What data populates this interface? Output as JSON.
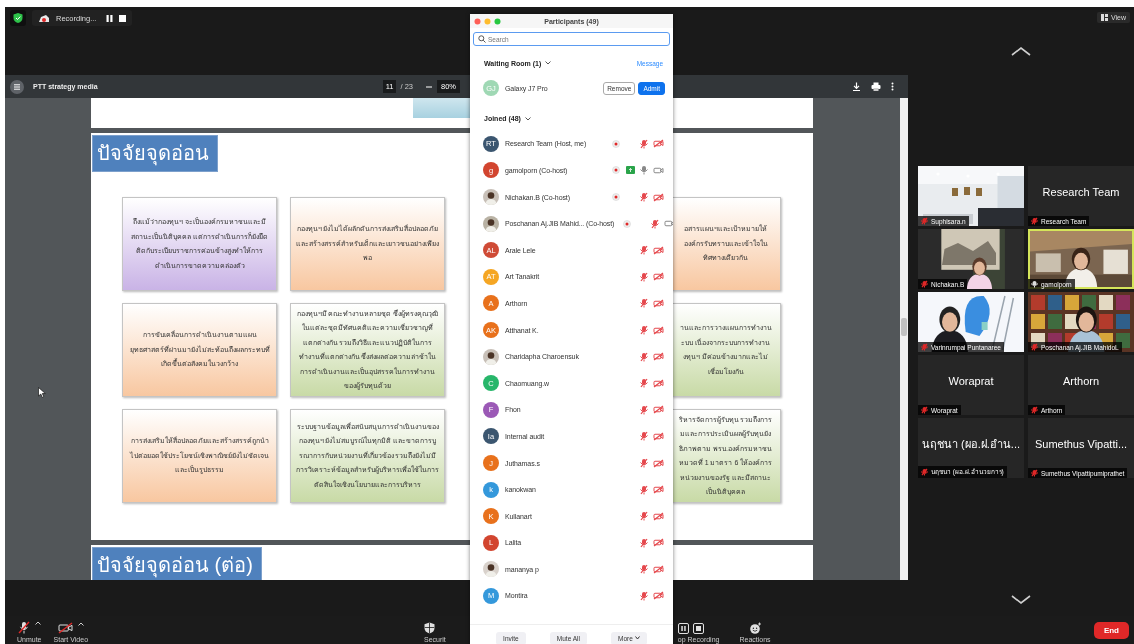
{
  "top_bar": {
    "recording_label": "Recording..."
  },
  "viewer": {
    "title": "PTT strategy media",
    "page": "11",
    "page_total": "/ 23",
    "zoom": "80%"
  },
  "slides": [
    {
      "title": "ปัจจัยจุดอ่อน",
      "boxes": [
        {
          "color": "#c9b3e6",
          "text": "ถึงแม้ว่ากองทุนฯ จะเป็นองค์กรมหาชนและมีสถานะเป็นนิติบุคคล แต่การดำเนินการก็ยังยึดติดกับระเบียบราชการค่อนข้างสูงทำให้การดำเนินการขาดความคล่องตัว"
        },
        {
          "color": "#f8c7a0",
          "text": "กองทุนฯ ยังไม่ได้ผลักดันการส่งเสริมสื่อปลอดภัยและสร้างสรรค์สำหรับเด็กและเยาวชนอย่างเพียงพอ"
        },
        {
          "color": "#f8c7a0",
          "text": "อสารแผนฯและเป้าหมายให้\nองค์กรรับทราบและเข้าใจใน\nทิศทางเดียวกัน"
        },
        {
          "color": "#f8c7a0",
          "text": "การขับเคลื่อนการดำเนินงานตามแผนยุทธศาสตร์ที่ผ่านมายังไม่สะท้อนถึงผลกระทบที่เกิดขึ้นต่อสังคมในวงกว้าง"
        },
        {
          "color": "#c8daa6",
          "text": "กองทุนฯมี คณะทำงานหลายชุด ซึ่งผู้ทรงคุณวุฒิในแต่ละชุดมีทัศนคติและความเชี่ยวชาญที่แตกต่างกัน รวมถึงวิธีและแนวปฏิบัติในการทำงานที่แตกต่างกัน ซึ่งส่งผลต่อความล่าช้าในการดำเนินงานและเป็นอุปสรรคในการทำงานของผู้รับทุนด้วย"
        },
        {
          "color": "#c8daa6",
          "text": "านและการวางแผนการทำงาน\nะบบ เนื่องจากระบบการทำงาน\nงทุนฯ มีค่อนข้างมากและไม่\nเชื่อมโยงกัน"
        },
        {
          "color": "#f8c7a0",
          "text": "การส่งเสริมให้สื่อปลอดภัยและสร้างสรรค์ถูกนำไปต่อยอดใช้ประโยชน์เชิงพาณิชย์ยังไม่ชัดเจนและเป็นรูปธรรม"
        },
        {
          "color": "#c8daa6",
          "text": "ระบบฐานข้อมูลเพื่อสนับสนุนการดำเนินงานของกองทุนฯ ยังไม่สมบูรณ์ในทุกมิติ และขาดการบูรณาการกับหน่วยงานที่เกี่ยวข้อง รวมถึงยังไม่มีการวิเคราะห์ข้อมูลสำหรับผู้บริหารเพื่อใช้ในการตัดสินใจเชิงนโยบายและการบริหาร"
        },
        {
          "color": "#c8daa6",
          "text": "ริหารจัดการผู้รับทุน รวมถึงการ\nมและการประเมินผลผู้รับทุนยัง\nธิภาพตาม พรบ.องค์กรมหาชน\nหมวดที่ 1 มาตรา 6 ให้องค์การ\nหน่วยงานของรัฐ และมีสถานะ\nเป็นนิติบุคคล"
        }
      ]
    },
    {
      "title": "ปัจจัยจุดอ่อน (ต่อ)"
    }
  ],
  "participants_panel": {
    "title": "Participants (49)",
    "search_placeholder": "Search",
    "waiting_heading": "Waiting Room (1)",
    "message_link": "Message",
    "waiting": [
      {
        "initials": "GJ",
        "color": "#9fd8b4",
        "name": "Galaxy J7 Pro"
      }
    ],
    "remove_button": "Remove",
    "admit_button": "Admit",
    "joined_heading": "Joined (48)",
    "joined": [
      {
        "kind": "initials",
        "initials": "RT",
        "color": "#3b5670",
        "name": "Research Team (Host, me)",
        "recording": true,
        "sharing": false,
        "muted": true,
        "video_off": true
      },
      {
        "kind": "initials",
        "initials": "g",
        "color": "#d2452f",
        "name": "gamolporn (Co-host)",
        "recording": true,
        "sharing": true,
        "muted": false,
        "video_off": false
      },
      {
        "name": "Nichakan.B (Co-host)",
        "recording": true,
        "sharing": false,
        "muted": true,
        "video_off": true
      },
      {
        "name": "Poschanan Aj.JIB Mahid... (Co-host)",
        "recording": true,
        "sharing": false,
        "muted": true,
        "video_off": false
      },
      {
        "kind": "initials",
        "initials": "AL",
        "color": "#cf4b36",
        "name": "Arale Lele",
        "recording": false,
        "sharing": false,
        "muted": true,
        "video_off": true
      },
      {
        "kind": "initials",
        "initials": "AT",
        "color": "#f5a623",
        "name": "Art Tanakrit",
        "recording": false,
        "sharing": false,
        "muted": true,
        "video_off": true
      },
      {
        "kind": "initials",
        "initials": "A",
        "color": "#e8711c",
        "name": "Arthorn",
        "recording": false,
        "sharing": false,
        "muted": true,
        "video_off": true
      },
      {
        "kind": "initials",
        "initials": "AK",
        "color": "#e8711c",
        "name": "Atthanat K.",
        "recording": false,
        "sharing": false,
        "muted": true,
        "video_off": true
      },
      {
        "name": "Charidapha Charoensuk",
        "recording": false,
        "sharing": false,
        "muted": true,
        "video_off": true
      },
      {
        "kind": "initials",
        "initials": "C",
        "color": "#27b66a",
        "name": "Chaomuang.w",
        "recording": false,
        "sharing": false,
        "muted": true,
        "video_off": true
      },
      {
        "kind": "initials",
        "initials": "F",
        "color": "#9b59b6",
        "name": "Fhon",
        "recording": false,
        "sharing": false,
        "muted": true,
        "video_off": true
      },
      {
        "kind": "initials",
        "initials": "Ia",
        "color": "#3b5670",
        "name": "Internal audit",
        "recording": false,
        "sharing": false,
        "muted": true,
        "video_off": true
      },
      {
        "kind": "initials",
        "initials": "J",
        "color": "#e8711c",
        "name": "Juthamas.s",
        "recording": false,
        "sharing": false,
        "muted": true,
        "video_off": true
      },
      {
        "kind": "initials",
        "initials": "k",
        "color": "#3498db",
        "name": "kanokwan",
        "recording": false,
        "sharing": false,
        "muted": true,
        "video_off": true
      },
      {
        "kind": "initials",
        "initials": "K",
        "color": "#e8711c",
        "name": "Kullanart",
        "recording": false,
        "sharing": false,
        "muted": true,
        "video_off": true
      },
      {
        "kind": "initials",
        "initials": "L",
        "color": "#d2452f",
        "name": "Lalita",
        "recording": false,
        "sharing": false,
        "muted": true,
        "video_off": true
      },
      {
        "name": "mananya p",
        "recording": false,
        "sharing": false,
        "muted": true,
        "video_off": true
      },
      {
        "kind": "initials",
        "initials": "M",
        "color": "#3498db",
        "name": "Montira",
        "recording": false,
        "sharing": false,
        "muted": true,
        "video_off": true
      }
    ],
    "buttons": [
      "Invite",
      "Mute All",
      "More"
    ]
  },
  "gallery": {
    "view_button": "View",
    "tiles": [
      {
        "kind": "picture",
        "label": "Suphisara.n",
        "muted": true,
        "speaking": false
      },
      {
        "kind": "name",
        "display_name": "Research Team",
        "label": "Research Team",
        "muted": true,
        "speaking": false
      },
      {
        "kind": "picture",
        "label": "Nichakan.B",
        "muted": true,
        "speaking": false
      },
      {
        "kind": "picture",
        "label": "gamolporn",
        "muted": false,
        "speaking": true
      },
      {
        "kind": "picture",
        "label": "Varinrumpai Puntanaree",
        "muted": true,
        "speaking": false
      },
      {
        "kind": "picture",
        "label": "Poschanan Aj.JIB MahidoL",
        "muted": true,
        "speaking": false
      },
      {
        "kind": "name",
        "display_name": "Woraprat",
        "label": "Woraprat",
        "muted": true,
        "speaking": false
      },
      {
        "kind": "name",
        "display_name": "Arthorn",
        "label": "Arthorn",
        "muted": true,
        "speaking": false
      },
      {
        "kind": "name",
        "display_name": "นฤชนา (ผอ.ฝ.อำน...",
        "label": "นฤชนา (ผอ.ฝ.อำนวยการ)",
        "muted": true,
        "speaking": false
      },
      {
        "kind": "name",
        "display_name": "Sumethus Vipatti...",
        "label": "Sumethus Vipattipumiprathet",
        "muted": true,
        "speaking": false
      }
    ]
  },
  "toolbar": {
    "items": [
      {
        "kind": "mic-muted",
        "label": "Unmute",
        "caret": true
      },
      {
        "kind": "video-off",
        "label": "Start Video",
        "caret": true
      },
      {
        "kind": "shield",
        "label": "Securit",
        "caret": false
      },
      {
        "kind": "recording-controls",
        "label": "op Recording",
        "caret": false
      },
      {
        "kind": "reactions",
        "label": "Reactions",
        "caret": false
      }
    ],
    "end_button": "End"
  }
}
